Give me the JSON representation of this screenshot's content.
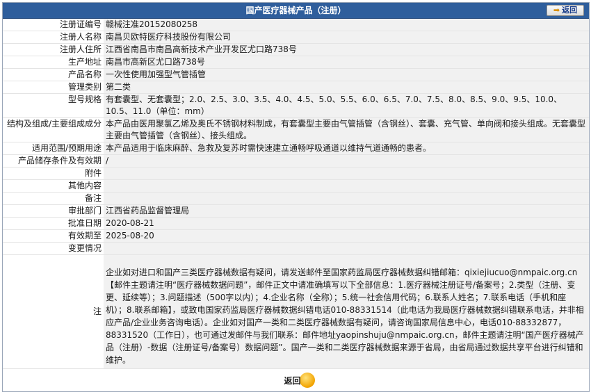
{
  "header": {
    "title": "国产医疗器械产品（注册）",
    "back_label": "返回"
  },
  "fields": [
    {
      "label": "注册证编号",
      "value": "赣械注准20152080258"
    },
    {
      "label": "注册人名称",
      "value": "南昌贝欧特医疗科技股份有限公司"
    },
    {
      "label": "注册人住所",
      "value": "江西省南昌市南昌高新技术产业开发区尤口路738号"
    },
    {
      "label": "生产地址",
      "value": "南昌市高新区尤口路738号"
    },
    {
      "label": "产品名称",
      "value": "一次性使用加强型气管插管"
    },
    {
      "label": "管理类别",
      "value": "第二类"
    },
    {
      "label": "型号规格",
      "value": "有套囊型、无套囊型；2.0、2.5、3.0、3.5、4.0、4.5、5.0、5.5、6.0、6.5、7.0、7.5、8.0、8.5、9.0、9.5、10.0、10.5、11.0（单位：mm）"
    },
    {
      "label": "结构及组成/主要组成成分",
      "value": "本产品由医用聚氯乙烯及奥氏不锈钢材料制成，有套囊型主要由气管插管（含钢丝）、套囊、充气管、单向阀和接头组成。无套囊型主要由气管插管（含钢丝）、接头组成。"
    },
    {
      "label": "适用范围/预期用途",
      "value": "本产品适用于临床麻醉、急救及复苏时需快速建立通畅呼吸通道以维持气道通畅的患者。"
    },
    {
      "label": "产品储存条件及有效期",
      "value": "/"
    },
    {
      "label": "附件",
      "value": ""
    },
    {
      "label": "其他内容",
      "value": ""
    },
    {
      "label": "备注",
      "value": ""
    },
    {
      "label": "审批部门",
      "value": "江西省药品监督管理局"
    },
    {
      "label": "批准日期",
      "value": "2020-08-21"
    },
    {
      "label": "有效期至",
      "value": "2025-08-20"
    },
    {
      "label": "变更情况",
      "value": ""
    }
  ],
  "note": {
    "label": "注",
    "text": "企业如对进口和国产三类医疗器械数据有疑问，请发送邮件至国家药监局医疗器械数据纠错邮箱：qixiejiucuo@nmpaic.org.cn【邮件主题请注明“医疗器械数据问题”，邮件正文中请准确填写以下全部信息：1.医疗器械注册证号/备案号；2.类型（注册、变更、延续等）；3.问题描述（500字以内）；4.企业名称（全称）；5.统一社会信用代码；6.联系人姓名；7.联系电话（手机和座机）；8.联系邮箱】，或致电国家药监局医疗器械数据纠错电话010-88331514（此电话为我局医疗器械数据纠错联系电话，并非相应产品/企业业务咨询电话）。企业如对国产一类和二类医疗器械数据有疑问，请咨询国家局信息中心，电话010-88332877，88331520（工作日），也可通过发邮件与我们联系：邮件地址yaopinshuju@nmpaic.org.cn，邮件主题请注明“国产医疗器械产品（注册）-数据（注册证号/备案号）数据问题”。国产一类和二类医疗器械数据来源于省局，由省局通过数据共享平台进行纠错和维护。"
  },
  "footer": {
    "back_label": "返回"
  },
  "colors": {
    "title_bar": "#2f5e9c",
    "value_bg": "#f1f1f1",
    "accent_orange": "#f2a300"
  },
  "icons": {
    "back_top": "right-arrow-icon",
    "back_bottom": "orange-circle-icon"
  }
}
